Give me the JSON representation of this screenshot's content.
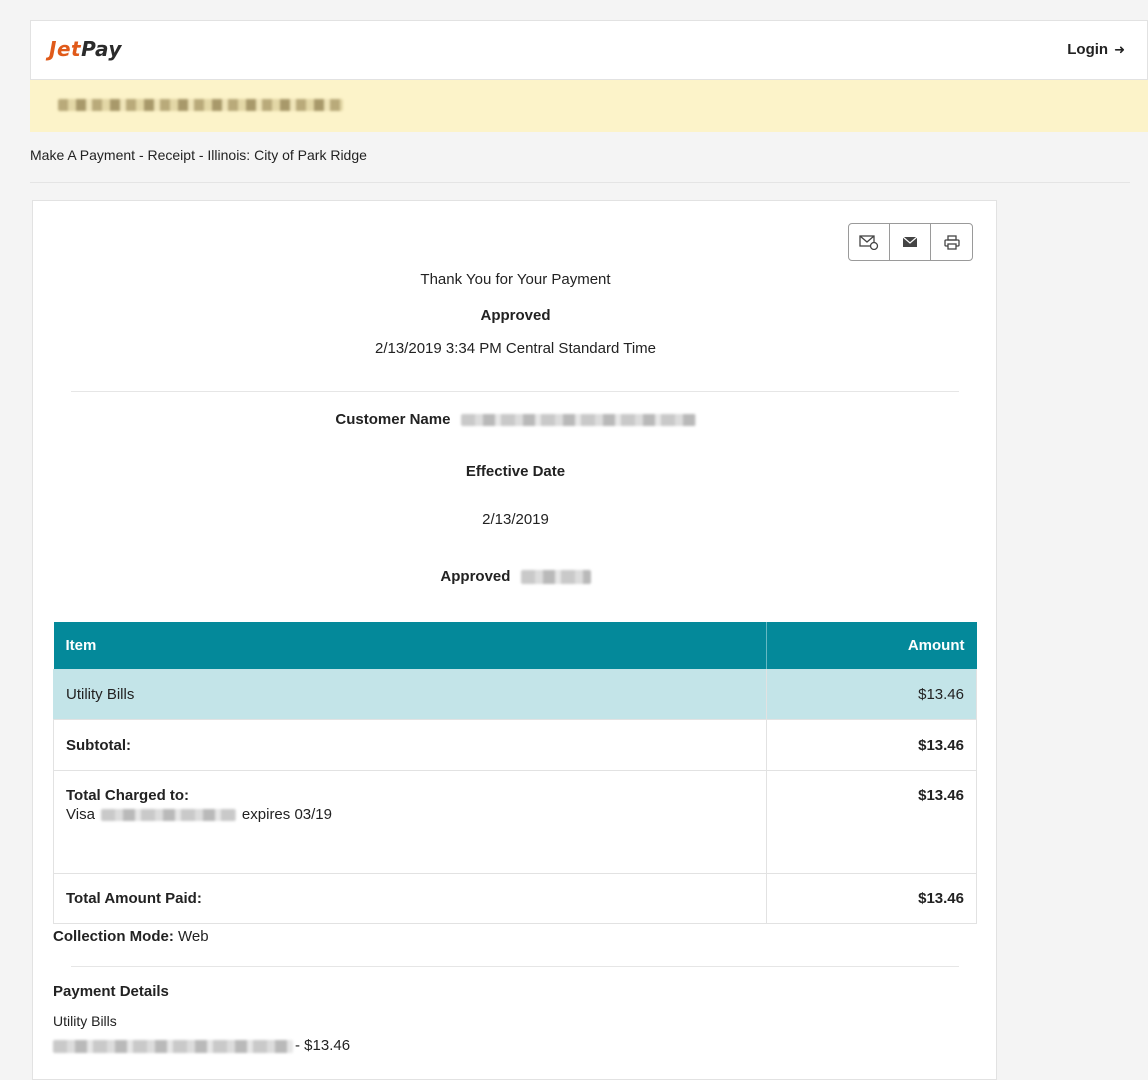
{
  "header": {
    "logo_part1": "Jet",
    "logo_part2": "Pay",
    "login_label": "Login",
    "login_icon": "sign-in-icon"
  },
  "breadcrumb": "Make A Payment - Receipt - Illinois: City of Park Ridge",
  "receipt": {
    "actions": [
      "email-attachment-icon",
      "envelope-icon",
      "print-icon"
    ],
    "thanks": "Thank You for Your Payment",
    "status": "Approved",
    "datetime": "2/13/2019 3:34 PM Central Standard Time",
    "customer_label": "Customer Name",
    "effective_date_label": "Effective Date",
    "effective_date": "2/13/2019",
    "approved_label": "Approved",
    "table": {
      "col_item": "Item",
      "col_amount": "Amount",
      "item_name": "Utility Bills",
      "item_amount": "$13.46",
      "subtotal_label": "Subtotal:",
      "subtotal_amount": "$13.46",
      "total_charged_label": "Total Charged to:",
      "card_brand": "Visa",
      "card_expiry": "expires 03/19",
      "total_charged_amount": "$13.46",
      "total_paid_label": "Total Amount Paid:",
      "total_paid_amount": "$13.46"
    },
    "collection_mode_label": "Collection Mode:",
    "collection_mode_value": "Web",
    "payment_details_title": "Payment Details",
    "payment_details_item": "Utility Bills",
    "payment_details_amount": "- $13.46"
  }
}
